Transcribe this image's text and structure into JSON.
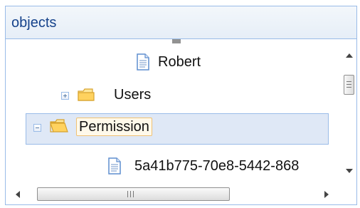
{
  "panel": {
    "title": "objects"
  },
  "tree": {
    "items": [
      {
        "label": "Robert",
        "icon": "document-icon",
        "expanded": null
      },
      {
        "label": "Users",
        "icon": "folder-icon",
        "expander": "plus"
      },
      {
        "label": "Permission",
        "icon": "folder-open-icon",
        "expander": "minus",
        "selected": true
      },
      {
        "label": "5a41b775-70e8-5442-868",
        "icon": "document-icon",
        "expanded": null
      }
    ]
  },
  "colors": {
    "header_bg": "#e6eef7",
    "border": "#99bbe8",
    "selection_bg": "#dfe8f6",
    "title_text": "#15428b",
    "folder": "#f2c14e"
  }
}
